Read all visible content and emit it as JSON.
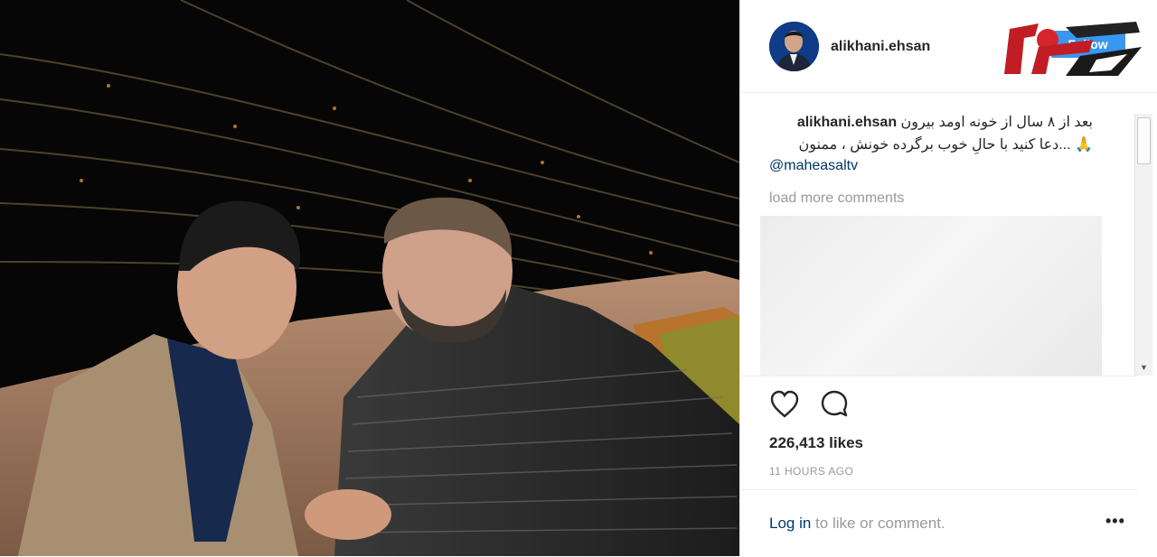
{
  "post": {
    "photo_description_icon": "photo",
    "username": "alikhani.ehsan",
    "follow_label": "Follow",
    "caption_user": "alikhani.ehsan",
    "caption_line1": "بعد از ۸ سال از خونه اومد بیرون",
    "caption_line2": "🙏 ...دعا کنید با حالِ خوب برگرده خونش ، ممنون",
    "mention": "@maheasaltv",
    "load_more": "load more comments",
    "likes": "226,413 likes",
    "time_ago": "11 HOURS AGO",
    "login_link": "Log in",
    "login_suffix": " to like or comment.",
    "more_label": "•••"
  },
  "scrollbar": {
    "up": "▲",
    "down": "▼"
  },
  "colors": {
    "accent": "#3897f0",
    "link": "#003569",
    "muted": "#999999"
  }
}
